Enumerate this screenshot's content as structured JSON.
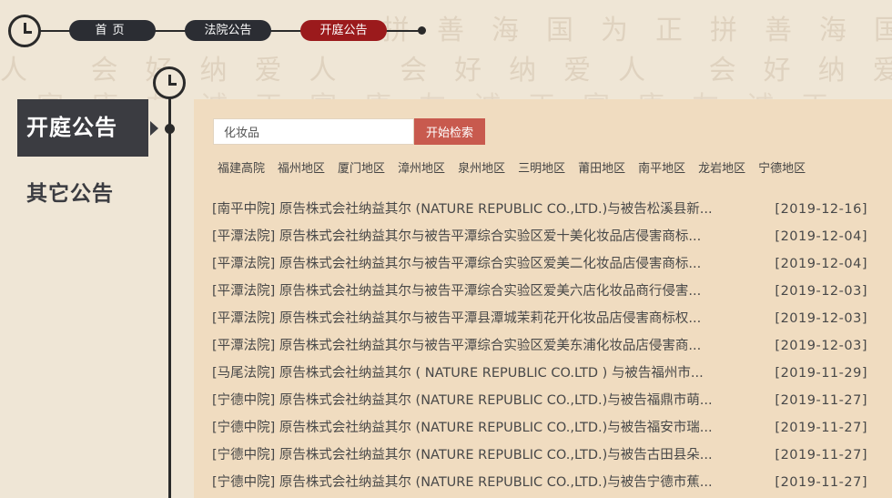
{
  "watermark": {
    "row1": "拼善海国为正拼善海国",
    "row2": "人 会好纳爱人 会好纳爱人 会好纳爱",
    "row3": "富康友诚正富康友诚正富康友诚正"
  },
  "breadcrumb": {
    "home": "首页",
    "court_notices": "法院公告",
    "hearing_notices": "开庭公告"
  },
  "nav": {
    "active": "开庭公告",
    "other": "其它公告"
  },
  "search": {
    "value": "化妆品",
    "placeholder": "",
    "button": "开始检索"
  },
  "regions": [
    "福建高院",
    "福州地区",
    "厦门地区",
    "漳州地区",
    "泉州地区",
    "三明地区",
    "莆田地区",
    "南平地区",
    "龙岩地区",
    "宁德地区"
  ],
  "notices": [
    {
      "title": "[南平中院] 原告株式会社纳益其尔 (NATURE REPUBLIC CO.,LTD.)与被告松溪县新...",
      "date": "[2019-12-16]"
    },
    {
      "title": "[平潭法院] 原告株式会社纳益其尔与被告平潭综合实验区爱十美化妆品店侵害商标...",
      "date": "[2019-12-04]"
    },
    {
      "title": "[平潭法院] 原告株式会社纳益其尔与被告平潭综合实验区爱美二化妆品店侵害商标...",
      "date": "[2019-12-04]"
    },
    {
      "title": "[平潭法院] 原告株式会社纳益其尔与被告平潭综合实验区爱美六店化妆品商行侵害...",
      "date": "[2019-12-03]"
    },
    {
      "title": "[平潭法院] 原告株式会社纳益其尔与被告平潭县潭城茉莉花开化妆品店侵害商标权...",
      "date": "[2019-12-03]"
    },
    {
      "title": "[平潭法院] 原告株式会社纳益其尔与被告平潭综合实验区爱美东浦化妆品店侵害商...",
      "date": "[2019-12-03]"
    },
    {
      "title": "[马尾法院] 原告株式会社纳益其尔 ( NATURE REPUBLIC CO.LTD ) 与被告福州市...",
      "date": "[2019-11-29]"
    },
    {
      "title": "[宁德中院] 原告株式会社纳益其尔 (NATURE REPUBLIC CO.,LTD.)与被告福鼎市萌...",
      "date": "[2019-11-27]"
    },
    {
      "title": "[宁德中院] 原告株式会社纳益其尔 (NATURE REPUBLIC CO.,LTD.)与被告福安市瑞...",
      "date": "[2019-11-27]"
    },
    {
      "title": "[宁德中院] 原告株式会社纳益其尔 (NATURE REPUBLIC CO.,LTD.)与被告古田县朵...",
      "date": "[2019-11-27]"
    },
    {
      "title": "[宁德中院] 原告株式会社纳益其尔 (NATURE REPUBLIC CO.,LTD.)与被告宁德市蕉...",
      "date": "[2019-11-27]"
    }
  ]
}
